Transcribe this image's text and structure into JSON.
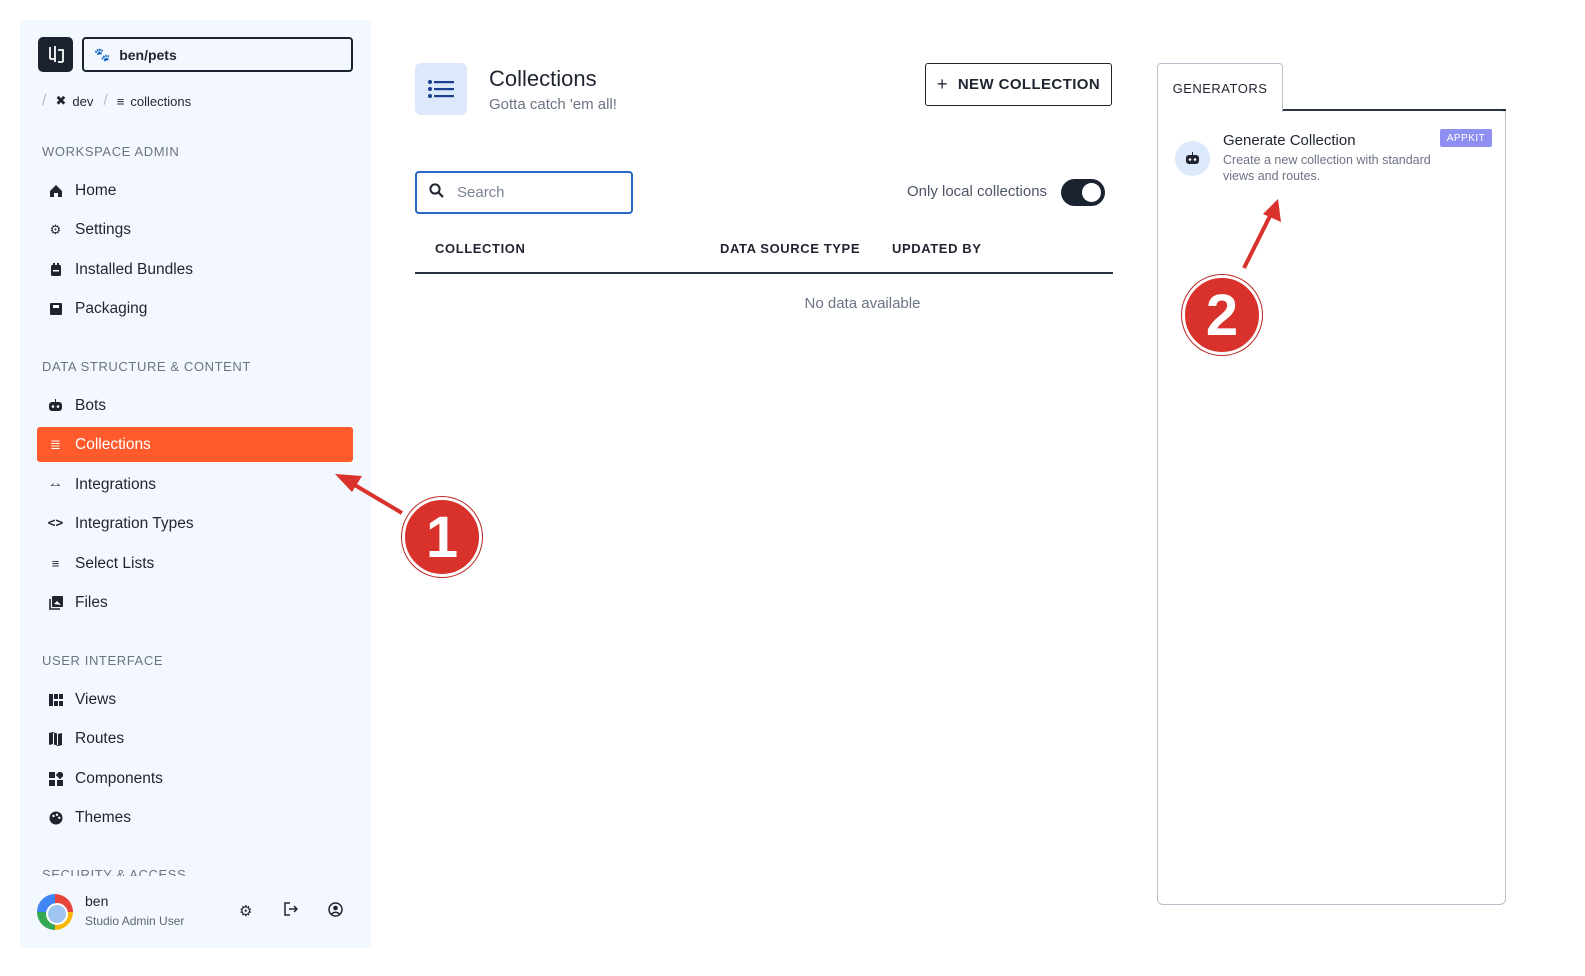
{
  "workspace": {
    "name": "ben/pets"
  },
  "breadcrumb": {
    "env": "dev",
    "page": "collections"
  },
  "sidebar": {
    "sections": [
      {
        "title": "WORKSPACE ADMIN",
        "items": [
          "Home",
          "Settings",
          "Installed Bundles",
          "Packaging"
        ]
      },
      {
        "title": "DATA STRUCTURE & CONTENT",
        "items": [
          "Bots",
          "Collections",
          "Integrations",
          "Integration Types",
          "Select Lists",
          "Files"
        ]
      },
      {
        "title": "USER INTERFACE",
        "items": [
          "Views",
          "Routes",
          "Components",
          "Themes"
        ]
      },
      {
        "title": "SECURITY & ACCESS"
      }
    ],
    "active_item": "Collections"
  },
  "user": {
    "name": "ben",
    "role": "Studio Admin User"
  },
  "header": {
    "title": "Collections",
    "subtitle": "Gotta catch 'em all!",
    "new_button": "NEW COLLECTION"
  },
  "search": {
    "placeholder": "Search"
  },
  "toggle": {
    "label": "Only local collections",
    "on": true
  },
  "table": {
    "columns": [
      "COLLECTION",
      "DATA SOURCE TYPE",
      "UPDATED BY"
    ],
    "empty_text": "No data available"
  },
  "generators": {
    "tab": "GENERATORS",
    "items": [
      {
        "title": "Generate Collection",
        "description": "Create a new collection with standard views and routes.",
        "badge": "APPKIT"
      }
    ]
  },
  "callouts": [
    "1",
    "2"
  ],
  "colors": {
    "accent": "#ff5a2b",
    "dark": "#1b2330",
    "badge": "#8f8ff2",
    "callout": "#d9312b"
  }
}
